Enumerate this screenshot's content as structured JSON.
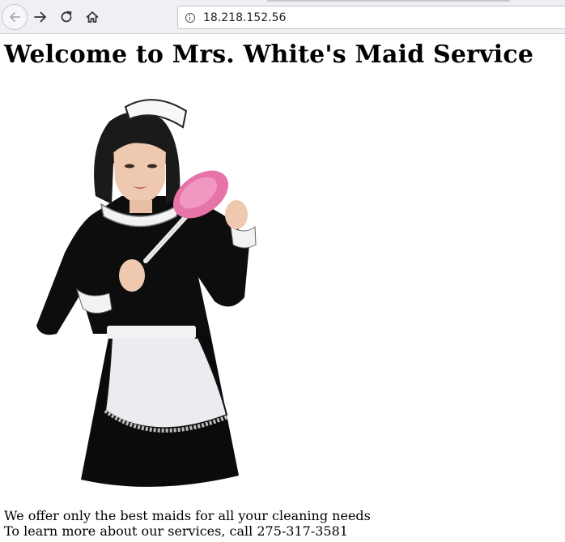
{
  "browser": {
    "url": "18.218.152.56",
    "icons": {
      "back": "back-arrow-icon",
      "forward": "forward-arrow-icon",
      "reload": "reload-icon",
      "home": "home-icon",
      "site_info": "info-icon"
    }
  },
  "page": {
    "title": "Welcome to Mrs. White's Maid Service",
    "image": {
      "subject": "maid-photo"
    },
    "line1": "We offer only the best maids for all your cleaning needs",
    "line2": "To learn more about our services, call 275-317-3581"
  }
}
